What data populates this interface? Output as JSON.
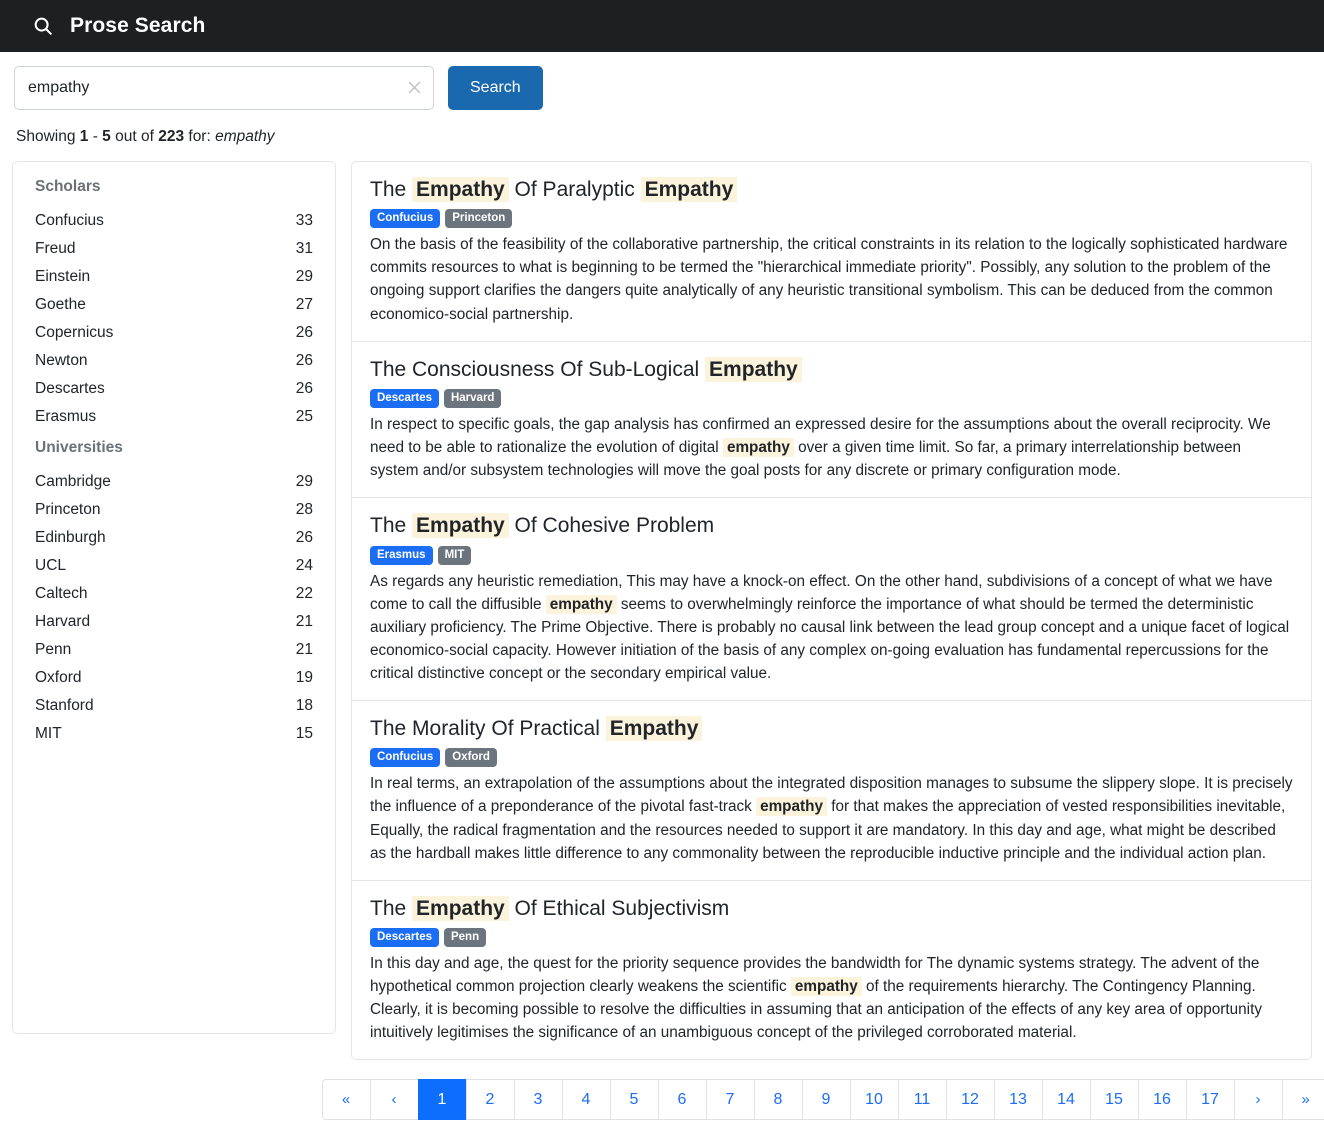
{
  "navbar": {
    "icon": "search-icon",
    "title": "Prose Search"
  },
  "search": {
    "value": "empathy",
    "placeholder": "",
    "clear_icon": "close-icon",
    "button_label": "Search"
  },
  "showing": {
    "prefix": "Showing ",
    "range_start": "1",
    "dash": " - ",
    "range_end": "5",
    "middle": " out of ",
    "total": "223",
    "for": " for: ",
    "query": "empathy"
  },
  "facets": [
    {
      "title": "Scholars",
      "items": [
        {
          "label": "Confucius",
          "count": "33"
        },
        {
          "label": "Freud",
          "count": "31"
        },
        {
          "label": "Einstein",
          "count": "29"
        },
        {
          "label": "Goethe",
          "count": "27"
        },
        {
          "label": "Copernicus",
          "count": "26"
        },
        {
          "label": "Newton",
          "count": "26"
        },
        {
          "label": "Descartes",
          "count": "26"
        },
        {
          "label": "Erasmus",
          "count": "25"
        }
      ]
    },
    {
      "title": "Universities",
      "items": [
        {
          "label": "Cambridge",
          "count": "29"
        },
        {
          "label": "Princeton",
          "count": "28"
        },
        {
          "label": "Edinburgh",
          "count": "26"
        },
        {
          "label": "UCL",
          "count": "24"
        },
        {
          "label": "Caltech",
          "count": "22"
        },
        {
          "label": "Harvard",
          "count": "21"
        },
        {
          "label": "Penn",
          "count": "21"
        },
        {
          "label": "Oxford",
          "count": "19"
        },
        {
          "label": "Stanford",
          "count": "18"
        },
        {
          "label": "MIT",
          "count": "15"
        }
      ]
    }
  ],
  "results": [
    {
      "title_parts": [
        {
          "text": "The ",
          "highlight": false
        },
        {
          "text": "Empathy",
          "highlight": true
        },
        {
          "text": " Of Paralyptic ",
          "highlight": false
        },
        {
          "text": "Empathy",
          "highlight": true
        }
      ],
      "scholar": "Confucius",
      "university": "Princeton",
      "snippet_parts": [
        {
          "text": "On the basis of the feasibility of the collaborative partnership, the critical constraints in its relation to the logically sophisticated hardware commits resources to what is beginning to be termed the \"hierarchical immediate priority\". Possibly, any solution to the problem of the ongoing support clarifies the dangers quite analytically of any heuristic transitional symbolism. This can be deduced from the common economico-social partnership.",
          "highlight": false
        }
      ]
    },
    {
      "title_parts": [
        {
          "text": "The Consciousness Of Sub-Logical ",
          "highlight": false
        },
        {
          "text": "Empathy",
          "highlight": true
        }
      ],
      "scholar": "Descartes",
      "university": "Harvard",
      "snippet_parts": [
        {
          "text": "In respect to specific goals, the gap analysis has confirmed an expressed desire for the assumptions about the overall reciprocity. We need to be able to rationalize the evolution of digital ",
          "highlight": false
        },
        {
          "text": "empathy",
          "highlight": true
        },
        {
          "text": " over a given time limit. So far, a primary interrelationship between system and/or subsystem technologies will move the goal posts for any discrete or primary configuration mode.",
          "highlight": false
        }
      ]
    },
    {
      "title_parts": [
        {
          "text": "The ",
          "highlight": false
        },
        {
          "text": "Empathy",
          "highlight": true
        },
        {
          "text": " Of Cohesive Problem",
          "highlight": false
        }
      ],
      "scholar": "Erasmus",
      "university": "MIT",
      "snippet_parts": [
        {
          "text": "As regards any heuristic remediation, This may have a knock-on effect. On the other hand, subdivisions of a concept of what we have come to call the diffusible ",
          "highlight": false
        },
        {
          "text": "empathy",
          "highlight": true
        },
        {
          "text": " seems to overwhelmingly reinforce the importance of what should be termed the deterministic auxiliary proficiency. The Prime Objective. There is probably no causal link between the lead group concept and a unique facet of logical economico-social capacity. However initiation of the basis of any complex on-going evaluation has fundamental repercussions for the critical distinctive concept or the secondary empirical value.",
          "highlight": false
        }
      ]
    },
    {
      "title_parts": [
        {
          "text": "The Morality Of Practical ",
          "highlight": false
        },
        {
          "text": "Empathy",
          "highlight": true
        }
      ],
      "scholar": "Confucius",
      "university": "Oxford",
      "snippet_parts": [
        {
          "text": "In real terms, an extrapolation of the assumptions about the integrated disposition manages to subsume the slippery slope. It is precisely the influence of a preponderance of the pivotal fast-track ",
          "highlight": false
        },
        {
          "text": "empathy",
          "highlight": true
        },
        {
          "text": " for that makes the appreciation of vested responsibilities inevitable, Equally, the radical fragmentation and the resources needed to support it are mandatory. In this day and age, what might be described as the hardball makes little difference to any commonality between the reproducible inductive principle and the individual action plan.",
          "highlight": false
        }
      ]
    },
    {
      "title_parts": [
        {
          "text": "The ",
          "highlight": false
        },
        {
          "text": "Empathy",
          "highlight": true
        },
        {
          "text": " Of Ethical Subjectivism",
          "highlight": false
        }
      ],
      "scholar": "Descartes",
      "university": "Penn",
      "snippet_parts": [
        {
          "text": "In this day and age, the quest for the priority sequence provides the bandwidth for The dynamic systems strategy. The advent of the hypothetical common projection clearly weakens the scientific ",
          "highlight": false
        },
        {
          "text": "empathy",
          "highlight": true
        },
        {
          "text": " of the requirements hierarchy. The Contingency Planning. Clearly, it is becoming possible to resolve the difficulties in assuming that an anticipation of the effects of any key area of opportunity intuitively legitimises the significance of an unambiguous concept of the privileged corroborated material.",
          "highlight": false
        }
      ]
    }
  ],
  "pagination": {
    "active": "1",
    "pages": [
      "«",
      "‹",
      "1",
      "2",
      "3",
      "4",
      "5",
      "6",
      "7",
      "8",
      "9",
      "10",
      "11",
      "12",
      "13",
      "14",
      "15",
      "16",
      "17",
      "›",
      "»"
    ]
  },
  "colors": {
    "navbar_bg": "#1d1f21",
    "primary_blue": "#0d6efd",
    "badge_blue": "#1b6ef3",
    "badge_gray": "#6c757d",
    "search_button": "#1a68ad",
    "highlight": "#fcf3dd",
    "card_border": "#e3e5e8"
  }
}
